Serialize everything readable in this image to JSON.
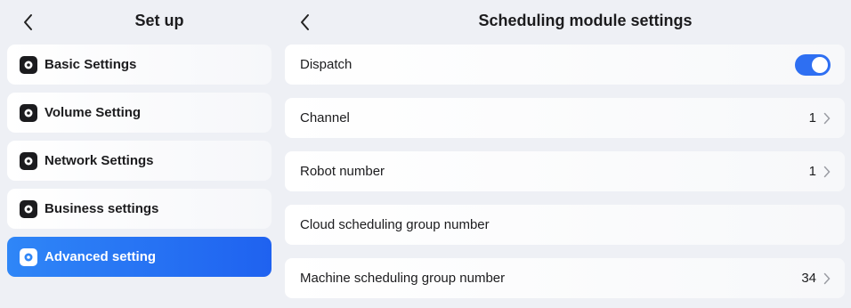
{
  "left_panel": {
    "title": "Set up",
    "items": [
      {
        "label": "Basic Settings",
        "icon": "gear-icon"
      },
      {
        "label": "Volume Setting",
        "icon": "gear-icon"
      },
      {
        "label": "Network Settings",
        "icon": "gear-icon"
      },
      {
        "label": "Business settings",
        "icon": "gear-icon"
      },
      {
        "label": "Advanced setting",
        "icon": "gear-icon",
        "active": true
      }
    ]
  },
  "right_panel": {
    "title": "Scheduling module settings",
    "rows": [
      {
        "label": "Dispatch",
        "toggle": true
      },
      {
        "label": "Channel",
        "value": "1"
      },
      {
        "label": "Robot number",
        "value": "1"
      },
      {
        "label": "Cloud scheduling group number",
        "value": ""
      },
      {
        "label": "Machine scheduling group number",
        "value": "34"
      }
    ]
  },
  "colors": {
    "accent": "#2e6ff2",
    "active_item": "#2f86f7",
    "background": "#eef0f5"
  }
}
